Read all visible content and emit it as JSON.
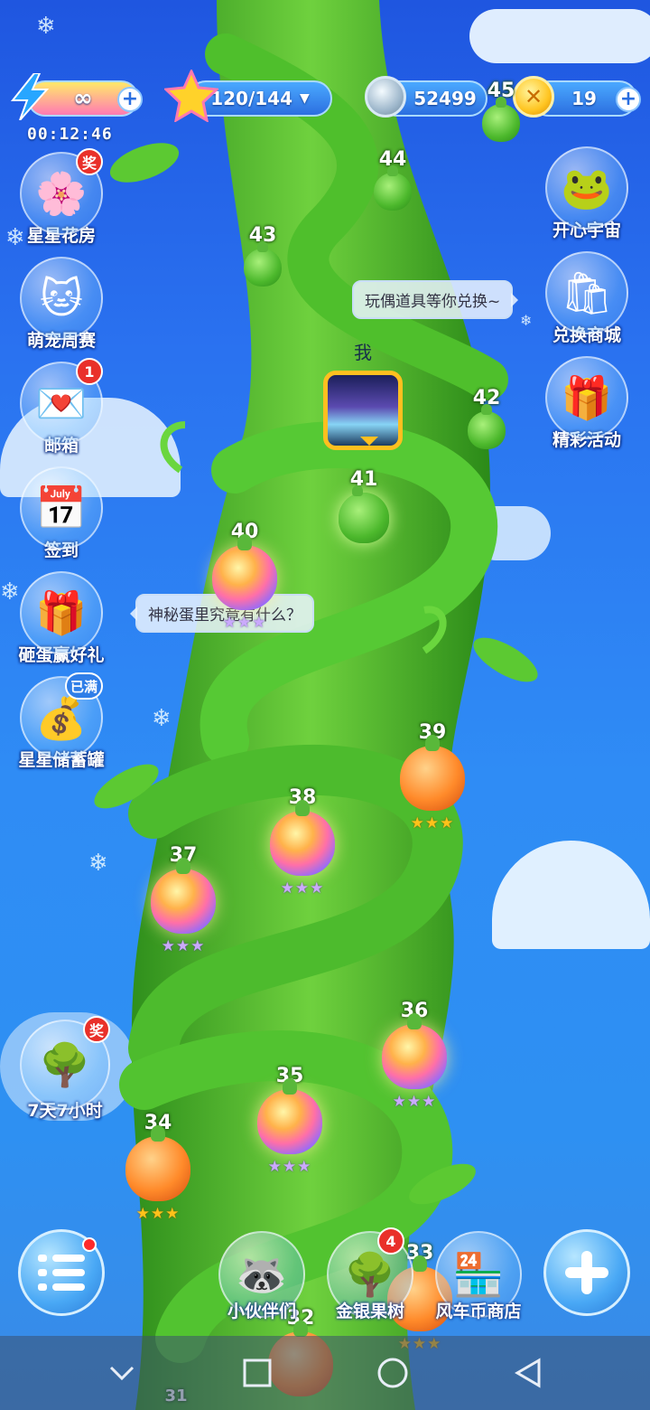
{
  "resources": {
    "energy": {
      "value": "∞",
      "timer": "00:12:46"
    },
    "stars": {
      "value": "120/144"
    },
    "coins": {
      "value": "52499"
    },
    "gold": {
      "value": "19"
    }
  },
  "left_menu": [
    {
      "label": "星星花房",
      "badge": "奖",
      "icon": "flower-house-icon"
    },
    {
      "label": "萌宠周赛",
      "badge": "",
      "icon": "pet-contest-icon"
    },
    {
      "label": "邮箱",
      "badge": "1",
      "icon": "mail-icon"
    },
    {
      "label": "签到",
      "badge": "",
      "icon": "checkin-calendar-icon"
    },
    {
      "label": "砸蛋赢好礼",
      "badge": "",
      "icon": "smash-egg-icon"
    },
    {
      "label": "星星储蓄罐",
      "badge": "已满",
      "icon": "star-piggybank-icon"
    }
  ],
  "right_menu": [
    {
      "label": "开心宇宙",
      "icon": "frog-universe-icon"
    },
    {
      "label": "兑换商城",
      "icon": "exchange-shop-icon"
    },
    {
      "label": "精彩活动",
      "icon": "gift-events-icon"
    }
  ],
  "promo": {
    "label": "7天7小时",
    "badge": "奖"
  },
  "tooltips": {
    "exchange": "玩偶道具等你兑换~",
    "egg": "神秘蛋里究竟有什么？"
  },
  "player_marker": "我",
  "levels": [
    {
      "num": "45",
      "type": "green",
      "stars": 0
    },
    {
      "num": "44",
      "type": "green",
      "stars": 0
    },
    {
      "num": "43",
      "type": "green",
      "stars": 0
    },
    {
      "num": "42",
      "type": "green",
      "stars": 0
    },
    {
      "num": "41",
      "type": "green",
      "stars": 0
    },
    {
      "num": "40",
      "type": "rainbow",
      "stars": 3,
      "star_color": "purple"
    },
    {
      "num": "39",
      "type": "orange",
      "stars": 3,
      "star_color": "gold"
    },
    {
      "num": "38",
      "type": "rainbow",
      "stars": 3,
      "star_color": "purple"
    },
    {
      "num": "37",
      "type": "rainbow",
      "stars": 3,
      "star_color": "purple"
    },
    {
      "num": "36",
      "type": "rainbow",
      "stars": 3,
      "star_color": "purple"
    },
    {
      "num": "35",
      "type": "rainbow",
      "stars": 3,
      "star_color": "purple"
    },
    {
      "num": "34",
      "type": "orange",
      "stars": 3,
      "star_color": "gold"
    },
    {
      "num": "33",
      "type": "orange",
      "stars": 3,
      "star_color": "gold"
    },
    {
      "num": "32",
      "type": "orange",
      "stars": 3,
      "star_color": "gold"
    },
    {
      "num": "31",
      "type": "orange",
      "stars": 0
    }
  ],
  "bottom_bar": {
    "menu": {
      "icon": "menu-list-icon"
    },
    "partners": {
      "label": "小伙伴们"
    },
    "fruit_tree": {
      "label": "金银果树",
      "badge": "4"
    },
    "windmill_shop": {
      "label": "风车币商店"
    },
    "add": {
      "icon": "plus-icon"
    }
  },
  "system_nav": [
    "chevron-down-icon",
    "square-icon",
    "circle-icon",
    "back-triangle-icon"
  ],
  "colors": {
    "sky": "#2a78ee",
    "stalk": "#3fae2a",
    "avatar_frame": "#ffbf1f"
  }
}
